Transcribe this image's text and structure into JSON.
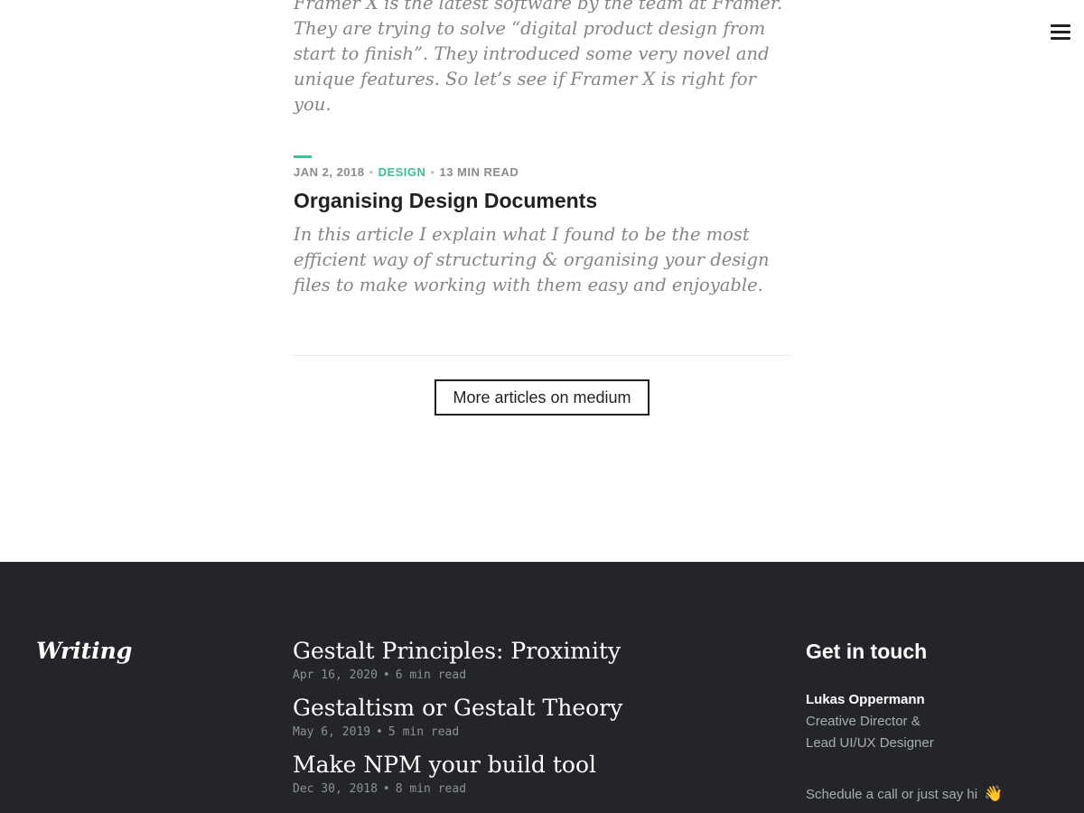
{
  "menu": {
    "icon": "hamburger-menu-icon"
  },
  "articles": [
    {
      "excerpt": "Framer X is the latest software by the team at Framer. They are trying to solve “digital product design from start to finish”. They introduced some very novel and unique features. So let’s see if Framer X is right for you."
    },
    {
      "date": "JAN 2, 2018",
      "separator": "•",
      "category": "DESIGN",
      "read_time": "13 MIN READ",
      "title": "Organising Design Documents",
      "excerpt": "In this article I explain what I found to be the most efficient way of structuring & organising your design files to make working with them easy and enjoyable."
    }
  ],
  "more_button_label": "More articles on medium",
  "colors": {
    "accent": "#3dbf99",
    "footer_bg": "#232529",
    "text_dark": "#1f2125",
    "excerpt": "#858585"
  },
  "footer": {
    "writing_heading": "Writing",
    "posts": [
      {
        "title": "Gestalt Principles: Proximity",
        "date": "Apr 16, 2020",
        "separator": "•",
        "read_time": "6 min read"
      },
      {
        "title": "Gestaltism or Gestalt Theory",
        "date": "May 6, 2019",
        "separator": "•",
        "read_time": "5 min read"
      },
      {
        "title": "Make NPM your build tool",
        "date": "Dec 30, 2018",
        "separator": "•",
        "read_time": "8 min read"
      }
    ],
    "contact": {
      "heading": "Get in touch",
      "name": "Lukas Oppermann",
      "role_line1": "Creative Director &",
      "role_line2": "Lead UI/UX Designer",
      "cta": "Schedule a call or just say hi",
      "cta_icon": "waving-hand-icon",
      "cta_emoji": "👋"
    }
  }
}
